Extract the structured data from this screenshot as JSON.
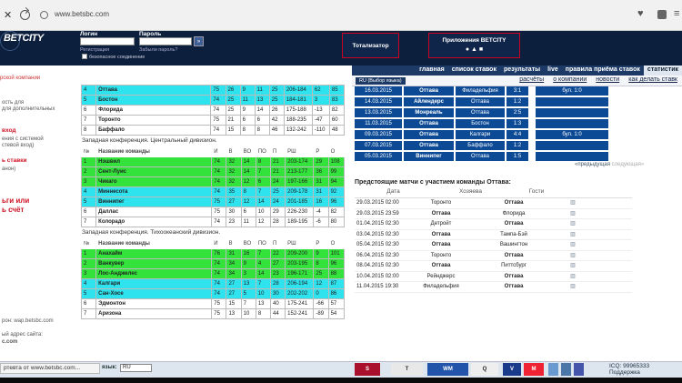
{
  "browser": {
    "close": "✕",
    "url": "www.betsbc.com"
  },
  "header": {
    "logo": "BETCITY",
    "tagline": "рской компании",
    "login_label": "Логин",
    "password_label": "Пароль",
    "register": "Регистрация",
    "forgot": "Забыли пароль?",
    "login_btn": "»",
    "safe": "безопасное соединение",
    "totalizator": "Тотализатор",
    "apps": "Приложения BETCITY",
    "apps_icons": "  "
  },
  "nav": [
    "главная",
    "список ставок",
    "результаты",
    "live",
    "правила приёма ставок",
    "статистик"
  ],
  "subnav": {
    "lang": "RU (Выбор языка)",
    "links": [
      "расчёты",
      "о компании",
      "новости",
      "как делать ставк"
    ]
  },
  "sidebar": {
    "items": [
      "ость для",
      "для дополнительных",
      "вход",
      "ения с системой",
      "стевой вход)",
      "ь ставки",
      "анон)",
      "ьги или",
      "ь счёт",
      "рон: wap.betsbc.com",
      "ый адрес сайта:",
      "c.com"
    ]
  },
  "standings": {
    "top": [
      [
        "4",
        "Оттава",
        "75",
        "26",
        "9",
        "11",
        "25",
        "206-184",
        "62",
        "85"
      ],
      [
        "5",
        "Бостон",
        "74",
        "25",
        "11",
        "13",
        "25",
        "184-181",
        "3",
        "83"
      ],
      [
        "6",
        "Флорида",
        "74",
        "25",
        "9",
        "14",
        "26",
        "175-188",
        "-13",
        "82"
      ],
      [
        "7",
        "Торонто",
        "75",
        "21",
        "6",
        "6",
        "42",
        "188-235",
        "-47",
        "60"
      ],
      [
        "8",
        "Баффало",
        "74",
        "15",
        "8",
        "8",
        "46",
        "132-242",
        "-110",
        "48"
      ]
    ],
    "central_title": "Западная конференция. Центральный дивизион.",
    "headers": [
      "№",
      "Название команды",
      "И",
      "В",
      "ВО",
      "ПО",
      "П",
      "РШ",
      "Р",
      "О"
    ],
    "central": [
      [
        "1",
        "Нэшвил",
        "74",
        "32",
        "14",
        "8",
        "21",
        "203-174",
        "29",
        "108"
      ],
      [
        "2",
        "Сент-Луис",
        "74",
        "32",
        "14",
        "7",
        "21",
        "213-177",
        "36",
        "99"
      ],
      [
        "3",
        "Чикаго",
        "74",
        "32",
        "12",
        "6",
        "24",
        "197-166",
        "31",
        "94"
      ],
      [
        "4",
        "Миннесота",
        "74",
        "35",
        "8",
        "7",
        "25",
        "209-178",
        "31",
        "92"
      ],
      [
        "5",
        "Виннипег",
        "75",
        "27",
        "12",
        "14",
        "24",
        "201-185",
        "16",
        "96"
      ],
      [
        "6",
        "Даллас",
        "75",
        "30",
        "6",
        "10",
        "29",
        "226-230",
        "-4",
        "82"
      ],
      [
        "7",
        "Колорадо",
        "74",
        "23",
        "11",
        "12",
        "28",
        "189-195",
        "-6",
        "80"
      ]
    ],
    "pacific_title": "Западная конференция. Тихоокеанский дивизион.",
    "pacific": [
      [
        "1",
        "Анахайм",
        "76",
        "31",
        "16",
        "7",
        "22",
        "209-200",
        "9",
        "101"
      ],
      [
        "2",
        "Ванкувер",
        "74",
        "34",
        "9",
        "4",
        "27",
        "203-195",
        "8",
        "96"
      ],
      [
        "3",
        "Лос-Анджелес",
        "74",
        "34",
        "3",
        "14",
        "23",
        "196-171",
        "25",
        "88"
      ],
      [
        "4",
        "Калгари",
        "74",
        "27",
        "13",
        "7",
        "28",
        "206-194",
        "12",
        "87"
      ],
      [
        "5",
        "Сан-Хосе",
        "74",
        "27",
        "5",
        "10",
        "30",
        "202-202",
        "0",
        "86"
      ],
      [
        "6",
        "Эдмонтон",
        "75",
        "15",
        "7",
        "13",
        "40",
        "175-241",
        "-66",
        "57"
      ],
      [
        "7",
        "Аризона",
        "75",
        "13",
        "10",
        "8",
        "44",
        "152-241",
        "-89",
        "54"
      ]
    ]
  },
  "results": [
    [
      "16.03.2015",
      "Оттава",
      "Филадельфия",
      "3:1",
      "бул. 1:0"
    ],
    [
      "14.03.2015",
      "Айлендерс",
      "Оттава",
      "1:2",
      ""
    ],
    [
      "13.03.2015",
      "Монреаль",
      "Оттава",
      "2:5",
      ""
    ],
    [
      "11.03.2015",
      "Оттава",
      "Бостон",
      "1:3",
      ""
    ],
    [
      "09.03.2015",
      "Оттава",
      "Калгари",
      "4:4",
      "бул. 1:0"
    ],
    [
      "07.03.2015",
      "Оттава",
      "Баффало",
      "1:2",
      ""
    ],
    [
      "05.03.2015",
      "Виннипег",
      "Оттава",
      "1:5",
      ""
    ]
  ],
  "pager": {
    "prev": "«предыдущая",
    "next": "следующая»"
  },
  "upcoming": {
    "title": "Предстоящие матчи с участием команды Оттава:",
    "headers": [
      "Дата",
      "Хозяева",
      "Гости"
    ],
    "rows": [
      [
        "29.03.2015 02:00",
        "Торонто",
        "Оттава"
      ],
      [
        "29.03.2015 23:59",
        "Оттава",
        "Флорида"
      ],
      [
        "01.04.2015 02:30",
        "Детройт",
        "Оттава"
      ],
      [
        "03.04.2015 02:30",
        "Оттава",
        "Тампа-Бэй"
      ],
      [
        "05.04.2015 02:30",
        "Оттава",
        "Вашингтон"
      ],
      [
        "06.04.2015 02:30",
        "Торонто",
        "Оттава"
      ],
      [
        "08.04.2015 02:30",
        "Оттава",
        "Питтсбург"
      ],
      [
        "10.04.2015 02:00",
        "Рейнджерс",
        "Оттава"
      ],
      [
        "11.04.2015 19:30",
        "Филадельфия",
        "Оттава"
      ]
    ]
  },
  "footer": {
    "status": "ртевта от www.betsbc.com...",
    "lang_label": "язык:",
    "lang": "RU",
    "icq": "ICQ: 99965333",
    "support": "Поддержка"
  }
}
